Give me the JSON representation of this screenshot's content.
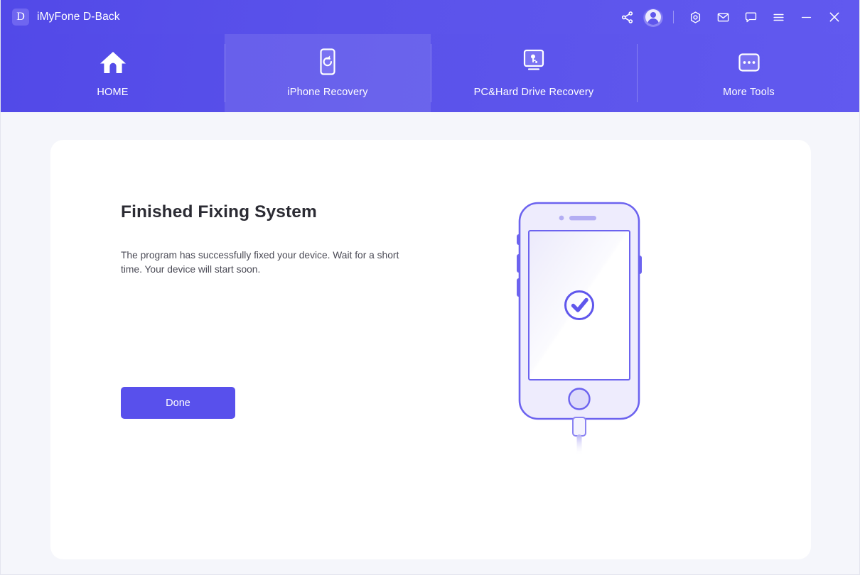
{
  "window": {
    "logo_letter": "D",
    "app_title": "iMyFone D-Back"
  },
  "titlebar": {
    "actions": [
      {
        "name": "share-icon",
        "label": "Share"
      },
      {
        "name": "account-icon",
        "label": "Account"
      },
      {
        "name": "settings-icon",
        "label": "Settings"
      },
      {
        "name": "mail-icon",
        "label": "Mail"
      },
      {
        "name": "feedback-icon",
        "label": "Feedback"
      },
      {
        "name": "menu-icon",
        "label": "Menu"
      },
      {
        "name": "minimize-icon",
        "label": "Minimize"
      },
      {
        "name": "close-icon",
        "label": "Close"
      }
    ]
  },
  "nav": {
    "tabs": [
      {
        "label": "HOME",
        "icon": "home-icon",
        "active": false
      },
      {
        "label": "iPhone Recovery",
        "icon": "phone-refresh-icon",
        "active": true
      },
      {
        "label": "PC&Hard Drive Recovery",
        "icon": "monitor-key-icon",
        "active": false
      },
      {
        "label": "More Tools",
        "icon": "more-dots-icon",
        "active": false
      }
    ]
  },
  "main": {
    "title": "Finished Fixing System",
    "description": "The program has successfully fixed your device. Wait for a short time. Your device will start soon.",
    "done_label": "Done",
    "illustration": {
      "name": "iphone-success-illustration",
      "status_icon": "check-circle-icon"
    }
  },
  "colors": {
    "header_gradient_start": "#5249e8",
    "header_gradient_end": "#6159ef",
    "accent": "#5850ec",
    "page_background": "#f5f6fb",
    "card_background": "#ffffff",
    "title_text": "#2b2b33",
    "body_text": "#4a4a55",
    "phone_outline": "#6c63ef",
    "phone_body": "#eeecfd"
  }
}
